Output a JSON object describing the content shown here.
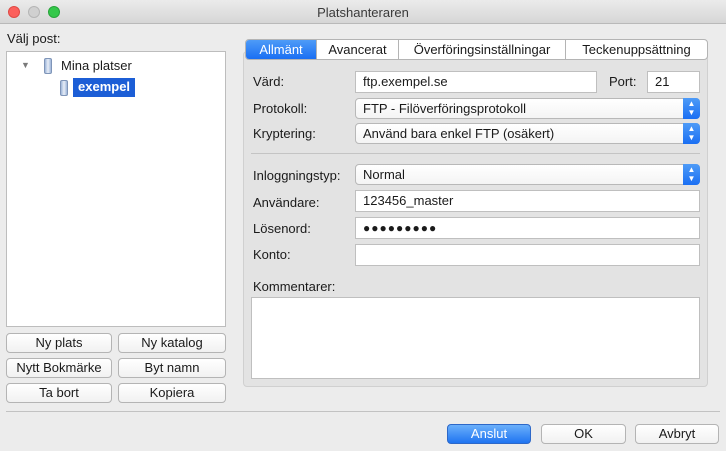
{
  "window": {
    "title": "Platshanteraren"
  },
  "left": {
    "label": "Välj post:",
    "tree": {
      "root": "Mina platser",
      "child": "exempel"
    },
    "buttons": {
      "new_site": "Ny plats",
      "new_folder": "Ny katalog",
      "new_bookmark": "Nytt Bokmärke",
      "rename": "Byt namn",
      "delete": "Ta bort",
      "copy": "Kopiera"
    }
  },
  "tabs": [
    "Allmänt",
    "Avancerat",
    "Överföringsinställningar",
    "Teckenuppsättning"
  ],
  "general": {
    "host_label": "Värd:",
    "host_value": "ftp.exempel.se",
    "port_label": "Port:",
    "port_value": "21",
    "protocol_label": "Protokoll:",
    "protocol_value": "FTP - Filöverföringsprotokoll",
    "encryption_label": "Kryptering:",
    "encryption_value": "Använd bara enkel FTP (osäkert)",
    "logon_type_label": "Inloggningstyp:",
    "logon_type_value": "Normal",
    "user_label": "Användare:",
    "user_value": "123456_master",
    "password_label": "Lösenord:",
    "password_value": "●●●●●●●●●",
    "account_label": "Konto:",
    "account_value": "",
    "comments_label": "Kommentarer:",
    "comments_value": ""
  },
  "footer": {
    "connect": "Anslut",
    "ok": "OK",
    "cancel": "Avbryt"
  },
  "colors": {
    "accent": "#1a6ff3",
    "selection": "#1c5ed6"
  }
}
